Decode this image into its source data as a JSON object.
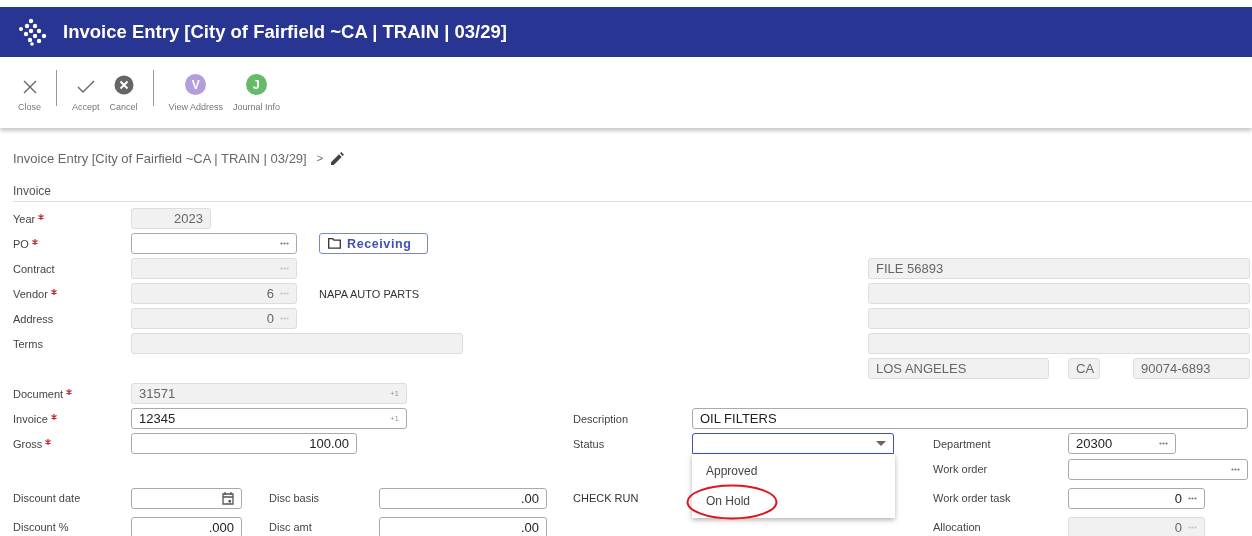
{
  "header": {
    "title": "Invoice Entry [City of Fairfield ~CA | TRAIN | 03/29]"
  },
  "toolbar_groups": [
    {
      "buttons": [
        {
          "label": "Close",
          "kind": "close"
        }
      ]
    },
    {
      "buttons": [
        {
          "label": "Accept",
          "kind": "accept"
        },
        {
          "label": "Cancel",
          "kind": "cancel"
        }
      ]
    },
    {
      "buttons": [
        {
          "label": "View Address",
          "kind": "letter",
          "letter": "V",
          "color": "#b39ddb"
        },
        {
          "label": "Journal Info",
          "kind": "letter",
          "letter": "J",
          "color": "#66bb6a"
        }
      ]
    }
  ],
  "breadcrumb": {
    "text": "Invoice Entry [City of Fairfield ~CA | TRAIN | 03/29]",
    "separator": ">"
  },
  "section": "Invoice",
  "form": {
    "year": {
      "label": "Year",
      "required": true,
      "value": "2023",
      "disabled": true
    },
    "po": {
      "label": "PO",
      "required": true,
      "kind": "lookup",
      "disabled": false
    },
    "receiving": {
      "label": "Receiving"
    },
    "contract": {
      "label": "Contract",
      "kind": "lookup",
      "disabled": true
    },
    "vendor": {
      "label": "Vendor",
      "required": true,
      "value": "6",
      "kind": "lookup",
      "disabled": true
    },
    "vendor_name": "NAPA AUTO PARTS",
    "address": {
      "label": "Address",
      "value": "0",
      "kind": "lookup",
      "disabled": true
    },
    "terms": {
      "label": "Terms",
      "disabled": true
    },
    "remit_lines": [
      {
        "value": "FILE 56893",
        "disabled": true
      },
      {
        "disabled": true
      },
      {
        "disabled": true
      },
      {
        "disabled": true
      }
    ],
    "city": {
      "value": "LOS ANGELES",
      "disabled": true
    },
    "state": {
      "value": "CA",
      "disabled": true
    },
    "zip": {
      "value": "90074-6893",
      "disabled": true
    },
    "document": {
      "label": "Document",
      "required": true,
      "value": "31571",
      "kind": "increment",
      "suffix": "+1",
      "disabled": true
    },
    "invoice": {
      "label": "Invoice",
      "required": true,
      "value": "12345",
      "kind": "increment",
      "suffix": "+1",
      "disabled": false
    },
    "gross": {
      "label": "Gross",
      "required": true,
      "value": "100.00",
      "disabled": false
    },
    "description": {
      "label": "Description",
      "value": "OIL FILTERS",
      "disabled": false
    },
    "status": {
      "label": "Status",
      "kind": "select",
      "disabled": false,
      "focused": true,
      "expanded": true,
      "options": [
        {
          "label": "Approved",
          "selected": false,
          "highlighted": false
        },
        {
          "label": "On Hold",
          "selected": false,
          "highlighted": true
        }
      ]
    },
    "department": {
      "label": "Department",
      "value": "20300",
      "kind": "lookup",
      "disabled": false
    },
    "work_order": {
      "label": "Work order",
      "kind": "lookup",
      "disabled": false
    },
    "discount_date": {
      "label": "Discount date",
      "kind": "date",
      "disabled": false
    },
    "disc_basis": {
      "label": "Disc basis",
      "value": ".00",
      "disabled": false
    },
    "check_run": "CHECK RUN",
    "work_order_task": {
      "label": "Work order task",
      "value": "0",
      "kind": "lookup",
      "disabled": false
    },
    "discount_pct": {
      "label": "Discount %",
      "value": ".000",
      "disabled": false
    },
    "disc_amt": {
      "label": "Disc amt",
      "value": ".00",
      "disabled": false
    },
    "allocation": {
      "label": "Allocation",
      "value": "0",
      "kind": "lookup",
      "disabled": true
    }
  }
}
